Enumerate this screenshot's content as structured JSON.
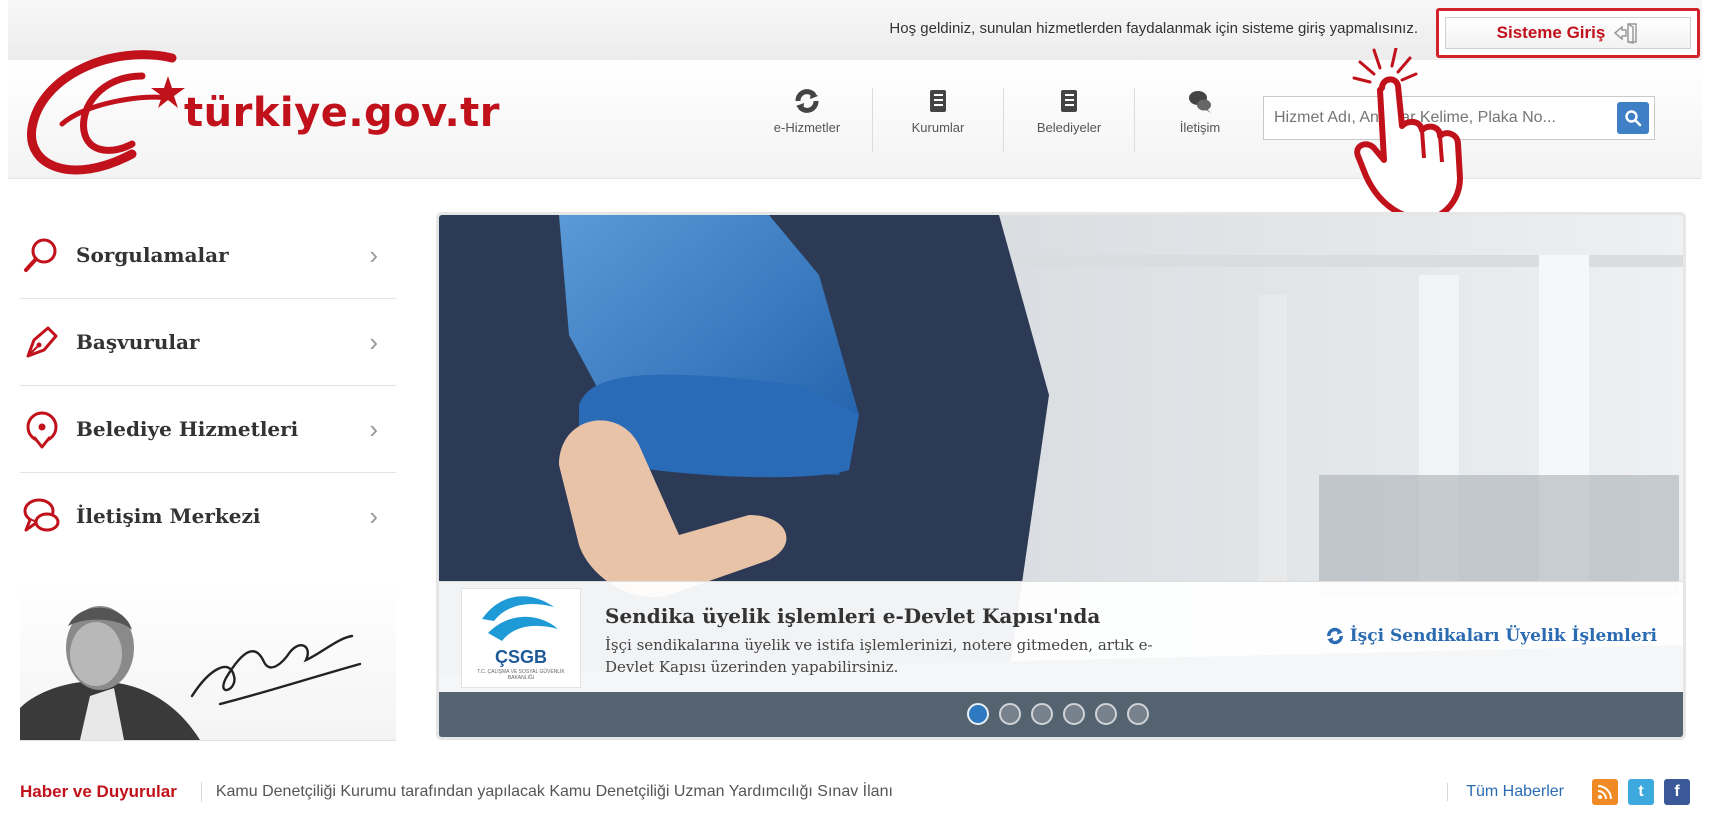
{
  "topbar": {
    "welcome_text": "Hoş geldiniz, sunulan hizmetlerden faydalanmak için sisteme giriş yapmalısınız.",
    "login_label": "Sisteme Giriş"
  },
  "logo": {
    "text": "türkiye.gov.tr"
  },
  "nav": {
    "items": [
      {
        "label": "e-Hizmetler",
        "icon": "refresh-icon"
      },
      {
        "label": "Kurumlar",
        "icon": "book-icon"
      },
      {
        "label": "Belediyeler",
        "icon": "book-icon"
      },
      {
        "label": "İletişim",
        "icon": "chat-icon"
      }
    ]
  },
  "search": {
    "placeholder": "Hizmet Adı, Anahtar Kelime, Plaka No..."
  },
  "sidebar": {
    "items": [
      {
        "label": "Sorgulamalar",
        "icon": "search-icon"
      },
      {
        "label": "Başvurular",
        "icon": "pen-icon"
      },
      {
        "label": "Belediye Hizmetleri",
        "icon": "location-pin-icon"
      },
      {
        "label": "İletişim Merkezi",
        "icon": "chat-bubbles-icon"
      }
    ]
  },
  "slider": {
    "logo_text": "ÇSGB",
    "logo_subtext": "T.C. ÇALIŞMA VE SOSYAL GÜVENLİK BAKANLIĞI",
    "title": "Sendika üyelik işlemleri e-Devlet Kapısı'nda",
    "description": "İşçi sendikalarına üyelik ve istifa işlemlerinizi, notere gitmeden, artık e-Devlet Kapısı üzerinden yapabilirsiniz.",
    "link_label": "İşçi Sendikaları Üyelik İşlemleri",
    "dot_count": 6,
    "active_dot": 0
  },
  "news": {
    "label": "Haber ve Duyurular",
    "headline": "Kamu Denetçiliği Kurumu tarafından yapılacak Kamu Denetçiliği Uzman Yardımcılığı Sınav İlanı",
    "all_label": "Tüm Haberler"
  },
  "colors": {
    "brand_red": "#c1121c",
    "link_blue": "#2a6bb1",
    "rss": "#f08a24",
    "twitter": "#3ea9dd",
    "facebook": "#3b5998"
  }
}
